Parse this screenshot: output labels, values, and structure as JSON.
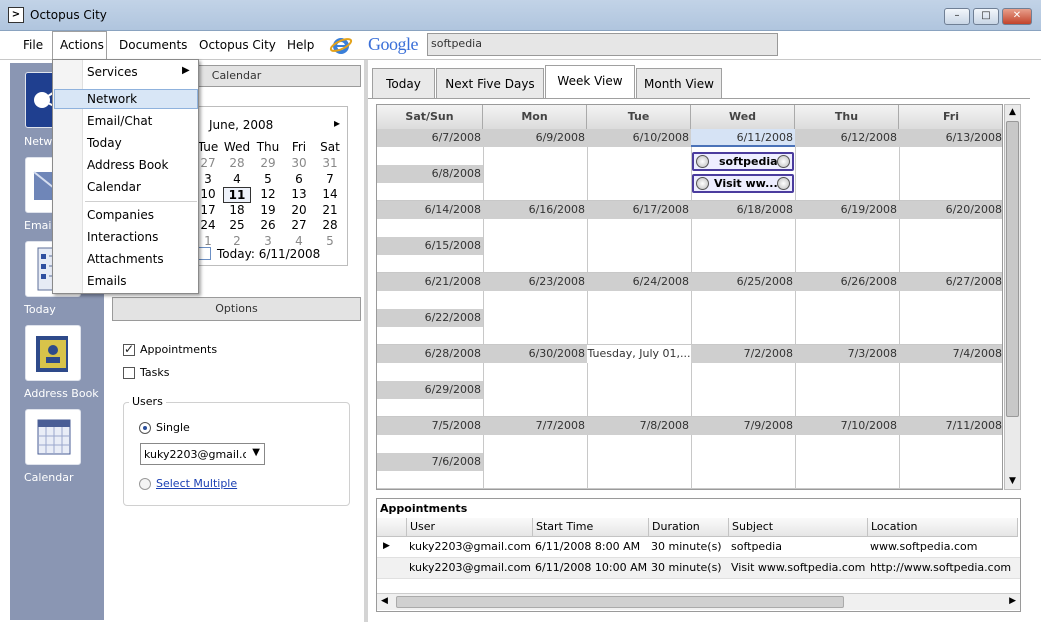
{
  "window": {
    "title": "Octopus City",
    "minimize": "–",
    "maximize": "□",
    "close": "✕"
  },
  "menubar": {
    "items": [
      "File",
      "Actions",
      "Documents",
      "Octopus City",
      "Help"
    ],
    "google": "Google",
    "search_value": "softpedia"
  },
  "sidebar": {
    "items": [
      "Network",
      "Email/Chat",
      "Today",
      "Address Book",
      "Calendar"
    ],
    "visible_labels": [
      "Netwo",
      "Email/",
      "Today",
      "Address Book",
      "Calendar"
    ]
  },
  "actions_menu": {
    "items": [
      "Services",
      "Network",
      "Email/Chat",
      "Today",
      "Address Book",
      "Calendar",
      "Companies",
      "Interactions",
      "Attachments",
      "Emails"
    ],
    "highlighted": "Network"
  },
  "calendar_panel": {
    "header": "Calendar",
    "month_label": "June, 2008",
    "next_arrow": "▸",
    "weekday_headers": [
      "Tue",
      "Wed",
      "Thu",
      "Fri",
      "Sat"
    ],
    "rows": [
      [
        "27",
        "28",
        "29",
        "30",
        "31"
      ],
      [
        "3",
        "4",
        "5",
        "6",
        "7"
      ],
      [
        "10",
        "11",
        "12",
        "13",
        "14"
      ],
      [
        "17",
        "18",
        "19",
        "20",
        "21"
      ],
      [
        "24",
        "25",
        "26",
        "27",
        "28"
      ],
      [
        "1",
        "2",
        "3",
        "4",
        "5"
      ]
    ],
    "today_label": "Today: 6/11/2008"
  },
  "options": {
    "header": "Options",
    "appointments_label": "Appointments",
    "appointments_checked": true,
    "tasks_label": "Tasks",
    "tasks_checked": false,
    "users_group": "Users",
    "single_label": "Single",
    "user_select": "kuky2203@gmail.com",
    "select_multiple": "Select Multiple"
  },
  "tabs": [
    "Today",
    "Next Five Days",
    "Week View",
    "Month View"
  ],
  "active_tab": "Week View",
  "week_grid": {
    "columns": [
      "Sat/Sun",
      "Mon",
      "Tue",
      "Wed",
      "Thu",
      "Fri"
    ],
    "weeks": [
      {
        "sat": "6/7/2008",
        "sun": "6/8/2008",
        "days": [
          "6/9/2008",
          "6/10/2008",
          "6/11/2008",
          "6/12/2008",
          "6/13/2008"
        ]
      },
      {
        "sat": "6/14/2008",
        "sun": "6/15/2008",
        "days": [
          "6/16/2008",
          "6/17/2008",
          "6/18/2008",
          "6/19/2008",
          "6/20/2008"
        ]
      },
      {
        "sat": "6/21/2008",
        "sun": "6/22/2008",
        "days": [
          "6/23/2008",
          "6/24/2008",
          "6/25/2008",
          "6/26/2008",
          "6/27/2008"
        ]
      },
      {
        "sat": "6/28/2008",
        "sun": "6/29/2008",
        "days": [
          "6/30/2008",
          "Tuesday, July 01,...",
          "7/2/2008",
          "7/3/2008",
          "7/4/2008"
        ]
      },
      {
        "sat": "7/5/2008",
        "sun": "7/6/2008",
        "days": [
          "7/7/2008",
          "7/8/2008",
          "7/9/2008",
          "7/10/2008",
          "7/11/2008"
        ]
      }
    ],
    "appointments": [
      "softpedia",
      "Visit ww..."
    ]
  },
  "appointments_table": {
    "title": "Appointments",
    "headers": [
      "User",
      "Start Time",
      "Duration",
      "Subject",
      "Location"
    ],
    "rows": [
      [
        "kuky2203@gmail.com",
        "6/11/2008 8:00 AM",
        "30 minute(s)",
        "softpedia",
        "www.softpedia.com"
      ],
      [
        "kuky2203@gmail.com",
        "6/11/2008 10:00 AM",
        "30 minute(s)",
        "Visit www.softpedia.com",
        "http://www.softpedia.com"
      ]
    ]
  },
  "colors": {
    "accent": "#4b3c9e",
    "sidebar": "#8a96b3",
    "date_bar": "#cfcfcf"
  }
}
